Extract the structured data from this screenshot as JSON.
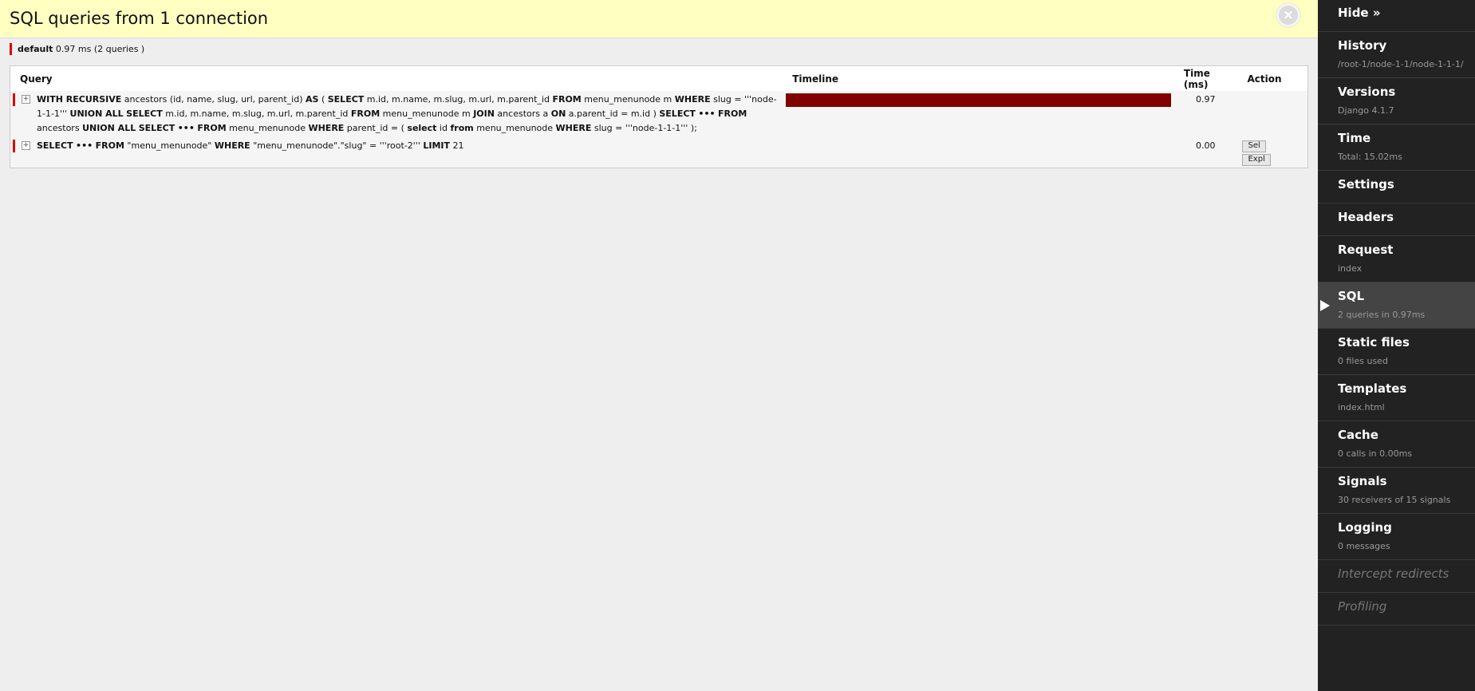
{
  "panel": {
    "title": "SQL queries from 1 connection",
    "close_icon": "×",
    "connection": {
      "alias": "default",
      "summary": "0.97 ms (2 queries )"
    }
  },
  "table": {
    "headers": {
      "query": "Query",
      "timeline": "Timeline",
      "time": "Time (ms)",
      "action": "Action"
    },
    "rows": [
      {
        "toggle": "+",
        "time": "0.97",
        "timeline_fraction": 1.0,
        "timeline_color": "#800000"
      },
      {
        "toggle": "+",
        "time": "0.00",
        "timeline_fraction": 0.0,
        "sel_label": "Sel",
        "expl_label": "Expl"
      }
    ]
  },
  "sidebar": {
    "hide": "Hide »",
    "items": [
      {
        "title": "History",
        "sub": "/root-1/node-1-1/node-1-1-1/"
      },
      {
        "title": "Versions",
        "sub": "Django 4.1.7"
      },
      {
        "title": "Time",
        "sub": "Total: 15.02ms"
      },
      {
        "title": "Settings",
        "sub": ""
      },
      {
        "title": "Headers",
        "sub": ""
      },
      {
        "title": "Request",
        "sub": "index"
      },
      {
        "title": "SQL",
        "sub": "2 queries in 0.97ms"
      },
      {
        "title": "Static files",
        "sub": "0 files used"
      },
      {
        "title": "Templates",
        "sub": "index.html"
      },
      {
        "title": "Cache",
        "sub": "0 calls in 0.00ms"
      },
      {
        "title": "Signals",
        "sub": "30 receivers of 15 signals"
      },
      {
        "title": "Logging",
        "sub": "0 messages"
      },
      {
        "title": "Intercept redirects",
        "sub": ""
      },
      {
        "title": "Profiling",
        "sub": ""
      }
    ]
  },
  "colors": {
    "header_bg": "#ffffc2",
    "marker": "#dd0000",
    "sidebar_bg": "#222222",
    "active_bg": "#444444"
  }
}
